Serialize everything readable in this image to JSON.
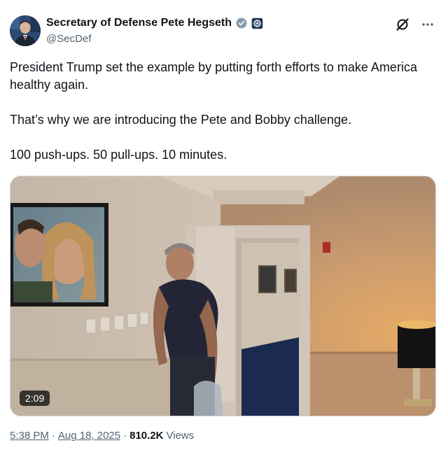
{
  "author": {
    "display_name": "Secretary of Defense Pete Hegseth",
    "handle": "@SecDef",
    "verified_icon": "gray-checkmark-badge",
    "affiliation_icon": "department-seal-badge"
  },
  "top_actions": {
    "grok_icon": "grok-icon",
    "more_icon": "more-dots-icon"
  },
  "post": {
    "paragraphs": [
      "President Trump set the example by putting forth efforts to make America healthy again.",
      "That’s why we are introducing the Pete and Bobby challenge.",
      "100 push-ups. 50 pull-ups. 10 minutes."
    ]
  },
  "media": {
    "type": "video",
    "duration": "2:09"
  },
  "meta": {
    "time": "5:38 PM",
    "separator": "·",
    "date": "Aug 18, 2025",
    "views_count": "810.2K",
    "views_label": "Views"
  },
  "colors": {
    "text": "#0f1419",
    "secondary": "#536471",
    "border": "#cfd9de"
  }
}
